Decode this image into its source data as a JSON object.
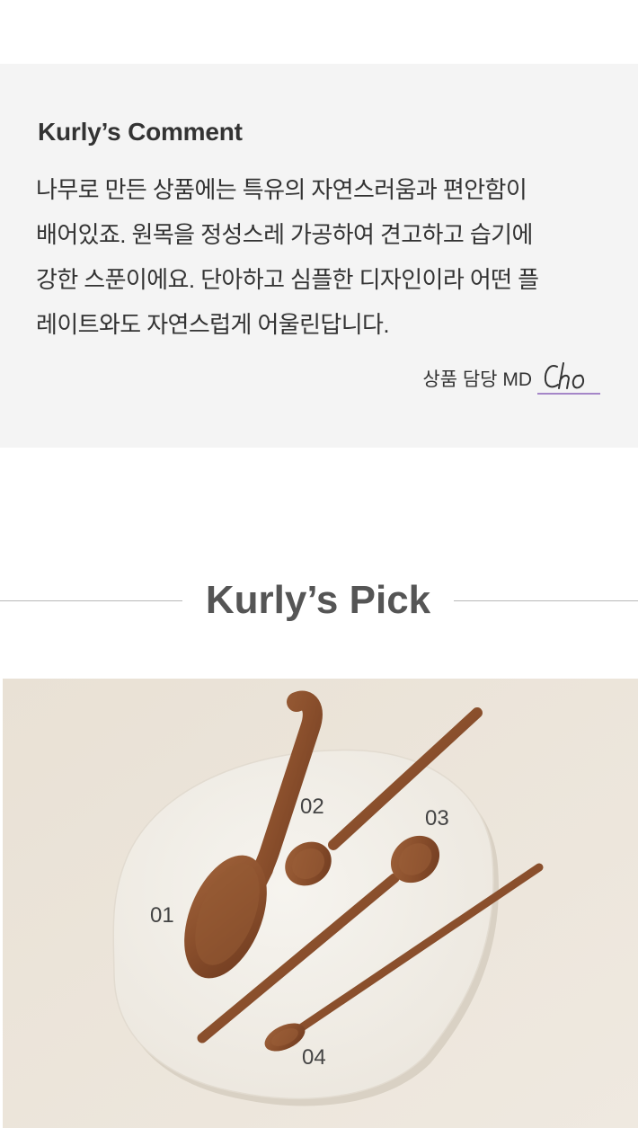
{
  "comment": {
    "title": "Kurly’s Comment",
    "lines": [
      "나무로 만든 상품에는 특유의 자연스러움과 편안함이",
      "배어있죠. 원목을 정성스레 가공하여 견고하고 습기에",
      "강한 스푼이에요. 단아하고 심플한 디자인이라 어떤 플",
      "레이트와도 자연스럽게 어울린답니다."
    ],
    "md_label": "상품 담당 MD",
    "md_name": "Cho",
    "accent_color": "#a586c8"
  },
  "pick": {
    "title": "Kurly’s Pick"
  },
  "photo": {
    "labels": [
      "01",
      "02",
      "03",
      "04"
    ],
    "colors": {
      "background": "#ebe4da",
      "plate": "#f3f0ea",
      "wood": "#8a4f2c"
    }
  }
}
